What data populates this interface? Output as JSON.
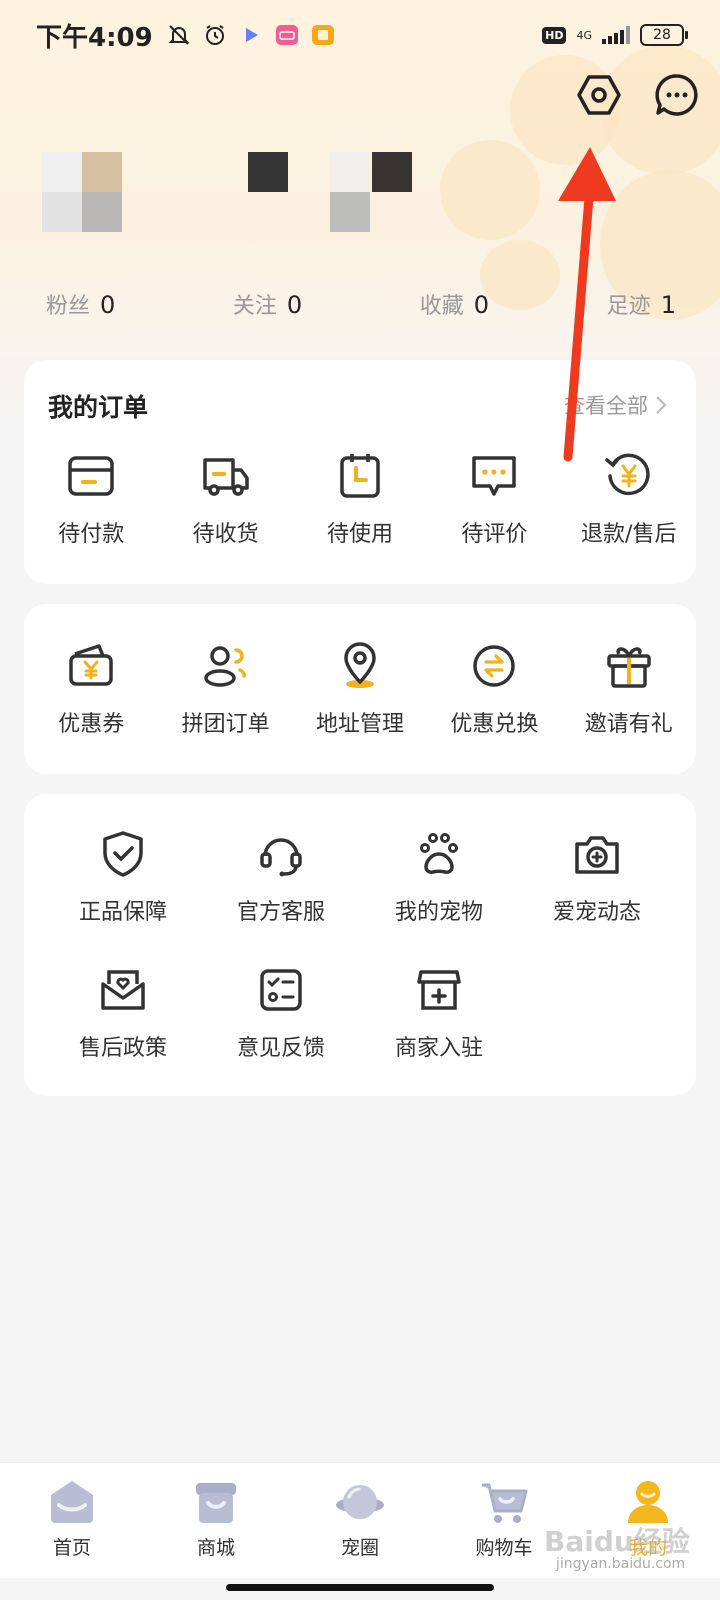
{
  "status_bar": {
    "time": "下午4:09",
    "hd": "HD",
    "network": "4G",
    "battery": "28"
  },
  "header": {
    "settings_icon": "settings-hexagon-icon",
    "message_icon": "chat-bubble-icon"
  },
  "stats": [
    {
      "label": "粉丝",
      "value": "0"
    },
    {
      "label": "关注",
      "value": "0"
    },
    {
      "label": "收藏",
      "value": "0"
    },
    {
      "label": "足迹",
      "value": "1"
    }
  ],
  "orders": {
    "title": "我的订单",
    "view_all": "查看全部",
    "items": [
      {
        "label": "待付款",
        "icon": "wallet-icon"
      },
      {
        "label": "待收货",
        "icon": "truck-icon"
      },
      {
        "label": "待使用",
        "icon": "calendar-clock-icon"
      },
      {
        "label": "待评价",
        "icon": "comment-icon"
      },
      {
        "label": "退款/售后",
        "icon": "refund-icon"
      }
    ]
  },
  "services": {
    "items": [
      {
        "label": "优惠券",
        "icon": "coupon-icon"
      },
      {
        "label": "拼团订单",
        "icon": "group-icon"
      },
      {
        "label": "地址管理",
        "icon": "location-icon"
      },
      {
        "label": "优惠兑换",
        "icon": "exchange-icon"
      },
      {
        "label": "邀请有礼",
        "icon": "gift-icon"
      }
    ]
  },
  "tools": {
    "row1": [
      {
        "label": "正品保障",
        "icon": "shield-check-icon"
      },
      {
        "label": "官方客服",
        "icon": "headset-icon"
      },
      {
        "label": "我的宠物",
        "icon": "paw-icon"
      },
      {
        "label": "爱宠动态",
        "icon": "camera-icon"
      }
    ],
    "row2": [
      {
        "label": "售后政策",
        "icon": "heart-mail-icon"
      },
      {
        "label": "意见反馈",
        "icon": "checklist-icon"
      },
      {
        "label": "商家入驻",
        "icon": "store-icon"
      }
    ]
  },
  "bottom_nav": [
    {
      "label": "首页",
      "icon": "home-icon"
    },
    {
      "label": "商城",
      "icon": "mall-icon"
    },
    {
      "label": "宠圈",
      "icon": "planet-icon"
    },
    {
      "label": "购物车",
      "icon": "cart-icon"
    },
    {
      "label": "我的",
      "icon": "profile-icon",
      "active": true
    }
  ],
  "watermark": {
    "brand": "Baidu经验",
    "url": "jingyan.baidu.com"
  },
  "colors": {
    "accent": "#f2b21b",
    "annotation": "#ee3b1f",
    "icon_stroke": "#333333"
  }
}
